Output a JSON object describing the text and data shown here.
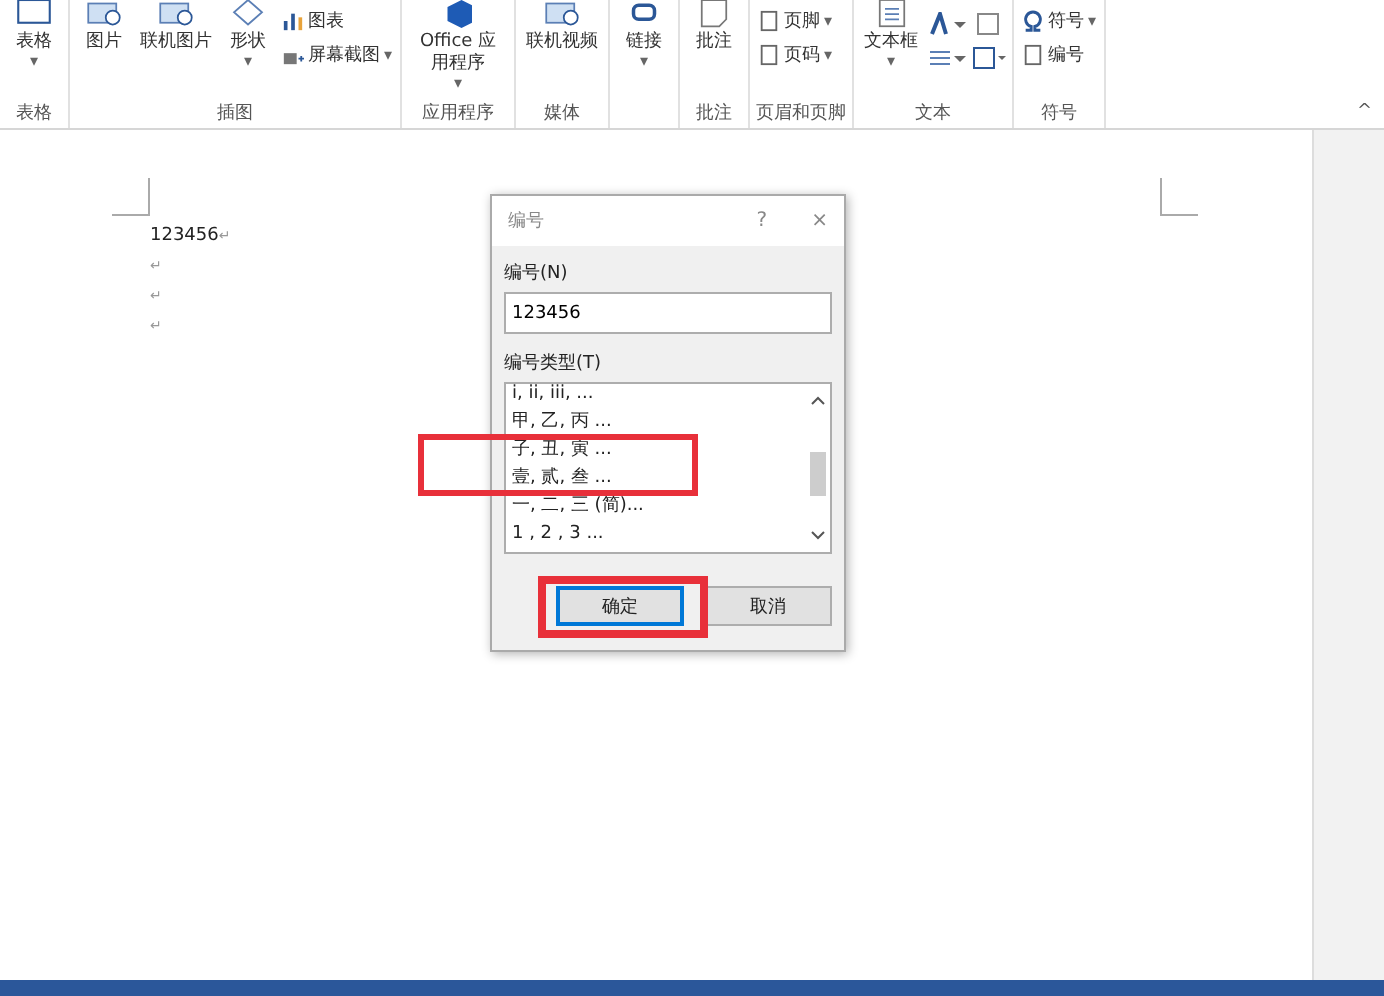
{
  "ribbon": {
    "groups": [
      {
        "label": "表格",
        "buttons": [
          {
            "label": "表格",
            "kind": "large",
            "caret": "▾"
          }
        ]
      },
      {
        "label": "插图",
        "buttons": [
          {
            "label": "图片",
            "kind": "large"
          },
          {
            "label": "联机图片",
            "kind": "large"
          },
          {
            "label": "形状",
            "kind": "large",
            "caret": "▾"
          },
          {
            "kind": "stack",
            "items": [
              {
                "label": "图表"
              },
              {
                "label": "屏幕截图",
                "caret": "▾"
              }
            ]
          }
        ]
      },
      {
        "label": "应用程序",
        "buttons": [
          {
            "label": "Office 应用程序",
            "kind": "large",
            "caret": "▾"
          }
        ]
      },
      {
        "label": "媒体",
        "buttons": [
          {
            "label": "联机视频",
            "kind": "large"
          }
        ]
      },
      {
        "buttons": [
          {
            "label": "链接",
            "kind": "large",
            "caret": "▾"
          }
        ]
      },
      {
        "label": "批注",
        "buttons": [
          {
            "label": "批注",
            "kind": "large"
          }
        ]
      },
      {
        "label": "页眉和页脚",
        "buttons": [
          {
            "kind": "stack",
            "items": [
              {
                "label": "页脚",
                "caret": "▾"
              },
              {
                "label": "页码",
                "caret": "▾"
              }
            ]
          }
        ]
      },
      {
        "label": "文本",
        "buttons": [
          {
            "label": "文本框",
            "kind": "large",
            "caret": "▾"
          },
          {
            "kind": "tools"
          }
        ]
      },
      {
        "label": "符号",
        "buttons": [
          {
            "kind": "stack",
            "items": [
              {
                "label": "符号",
                "caret": "▾"
              },
              {
                "label": "编号"
              }
            ]
          }
        ]
      }
    ],
    "collapse": "^"
  },
  "document": {
    "lines": [
      {
        "text": "123456",
        "mark": "↵"
      },
      {
        "mark": "↵"
      },
      {
        "mark": "↵"
      },
      {
        "mark": "↵"
      }
    ]
  },
  "dialog": {
    "title": "编号",
    "help": "?",
    "close": "×",
    "field_label": "编号(N)",
    "field_value": "123456",
    "list_label": "编号类型(T)",
    "list_items": [
      "i, ii, iii, ...",
      "甲, 乙, 丙 ...",
      "子, 丑, 寅 ...",
      "壹, 贰, 叁 ...",
      "一, 二, 三 (简)...",
      "1 , 2 , 3 ..."
    ],
    "buttons": [
      {
        "label": "确定",
        "default": true
      },
      {
        "label": "取消",
        "default": false
      }
    ]
  }
}
